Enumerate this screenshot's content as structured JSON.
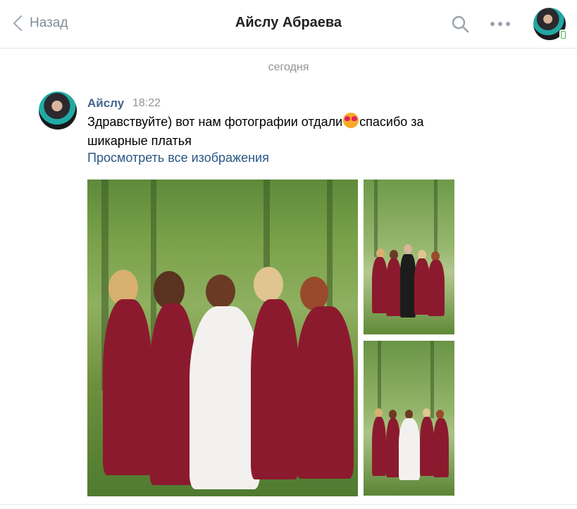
{
  "header": {
    "back_label": "Назад",
    "title": "Айслу Абраева"
  },
  "conversation": {
    "date_separator": "сегодня"
  },
  "message": {
    "author": "Айслу",
    "time": "18:22",
    "text_before_emoji": "Здравствуйте) вот нам фотографии отдали",
    "emoji": "heart-eyes-emoji",
    "text_after_emoji": "спасибо за шикарные платья",
    "view_all_link": "Просмотреть все изображения"
  },
  "attachments": [
    {
      "description": "photo-bridesmaids-back-view"
    },
    {
      "description": "photo-group-with-groom"
    },
    {
      "description": "photo-group-with-bride"
    }
  ],
  "colors": {
    "link": "#2a5885",
    "author": "#42648b",
    "muted": "#939393",
    "dress": "#8c1a2e",
    "online_mobile": "#4bb34b"
  }
}
